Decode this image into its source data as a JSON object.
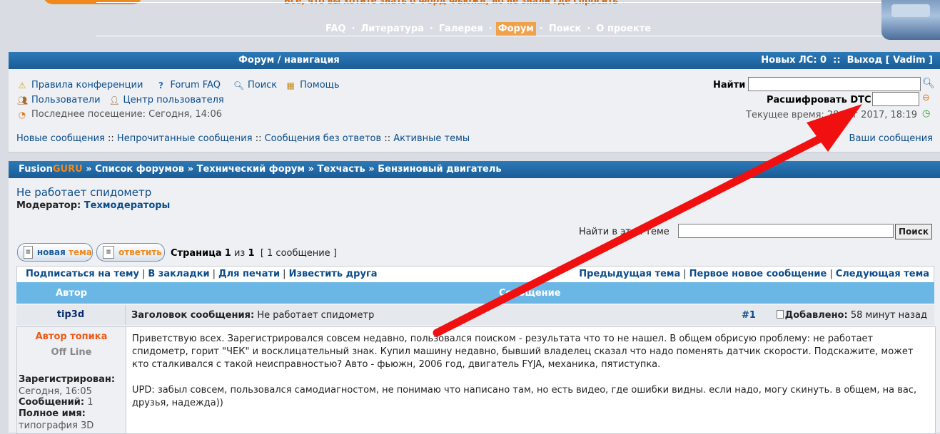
{
  "header": {
    "slogan": "Все, что вы хотите знать о Форд Фьюжн, но не знали где спросить",
    "nav": [
      {
        "label": "FAQ",
        "active": false
      },
      {
        "label": "Литература",
        "active": false
      },
      {
        "label": "Галерея",
        "active": false
      },
      {
        "label": "Форум",
        "active": true
      },
      {
        "label": "Поиск",
        "active": false
      },
      {
        "label": "О проекте",
        "active": false
      }
    ],
    "nav_sep": "·"
  },
  "navbar": {
    "title": "Форум / навигация",
    "new_pm": "Новых ЛС: 0",
    "sep": "::",
    "logout": "Выход [ Vadim ]"
  },
  "links": {
    "rules": "Правила конференции",
    "faq": "Forum FAQ",
    "search": "Поиск",
    "help": "Помощь",
    "users": "Пользователи",
    "ucp": "Центр пользователя",
    "last_visit": "Последнее посещение: Сегодня, 14:06",
    "new_posts": "Новые сообщения",
    "unread": "Непрочитанные сообщения",
    "unanswered": "Сообщения без ответов",
    "active": "Активные темы",
    "sep": "::",
    "your_posts": "Ваши сообщения"
  },
  "quick": {
    "find_label": "Найти",
    "dtc_label": "Расшифровать DTC",
    "current_time": "Текущее время: 28 авг 2017, 18:19"
  },
  "breadcrumb": {
    "site_a": "Fusion",
    "site_b": "GURU",
    "items": [
      "Список форумов",
      "Технический форум",
      "Техчасть",
      "Бензиновый двигатель"
    ],
    "sep": "»"
  },
  "topic": {
    "title": "Не работает спидометр",
    "moderator_label": "Модератор:",
    "moderator": "Техмодераторы",
    "search_label": "Найти в этой теме",
    "search_button": "Поиск",
    "new_topic_a": "новая",
    "new_topic_b": "тема",
    "reply": "ответить",
    "pager_label": "Страница",
    "pager_cur": "1",
    "pager_of": "из",
    "pager_total": "1",
    "pager_count": "[ 1 сообщение ]"
  },
  "tools": {
    "left": [
      "Подписаться на тему",
      "В закладки",
      "Для печати",
      "Известить друга"
    ],
    "right": [
      "Предыдущая тема",
      "Первое новое сообщение",
      "Следующая тема"
    ],
    "sep": "|"
  },
  "table": {
    "col_author": "Автор",
    "col_message": "Сообщение"
  },
  "post": {
    "author": "tip3d",
    "subject_label": "Заголовок сообщения:",
    "subject": "Не работает спидометр",
    "num": "#1",
    "added_label": "Добавлено:",
    "added": "58 минут назад",
    "topic_author": "Автор топика",
    "status": "Off Line",
    "registered_label": "Зарегистрирован:",
    "registered": "Сегодня, 16:05",
    "posts_label": "Сообщений:",
    "posts": "1",
    "fullname_label": "Полное имя:",
    "fullname": "типография 3D",
    "text_1": "Приветствую всех. Зарегистрировался совсем недавно, пользовался поиском - результата что то не нашел. В общем обрисую проблему: не работает спидометр, горит \"ЧЕК\" и восклицательный знак. Купил машину недавно, бывший владелец сказал что надо поменять датчик скорости. Подскажите, может кто сталкивался с такой неисправностью? Авто - фьюжн, 2006 год, двигатель FYJA, механика, пятиступка.",
    "text_2": "UPD: забыл совсем, пользовался самодиагностом, не понимаю что написано там, но есть видео, где ошибки видны. если надо, могу скинуть. в общем, на вас, друзья, надежда))"
  },
  "colors": {
    "bar": "#1a5c96",
    "accent": "#f0891d",
    "link": "#0b4c8c",
    "arrow": "#f01010"
  }
}
